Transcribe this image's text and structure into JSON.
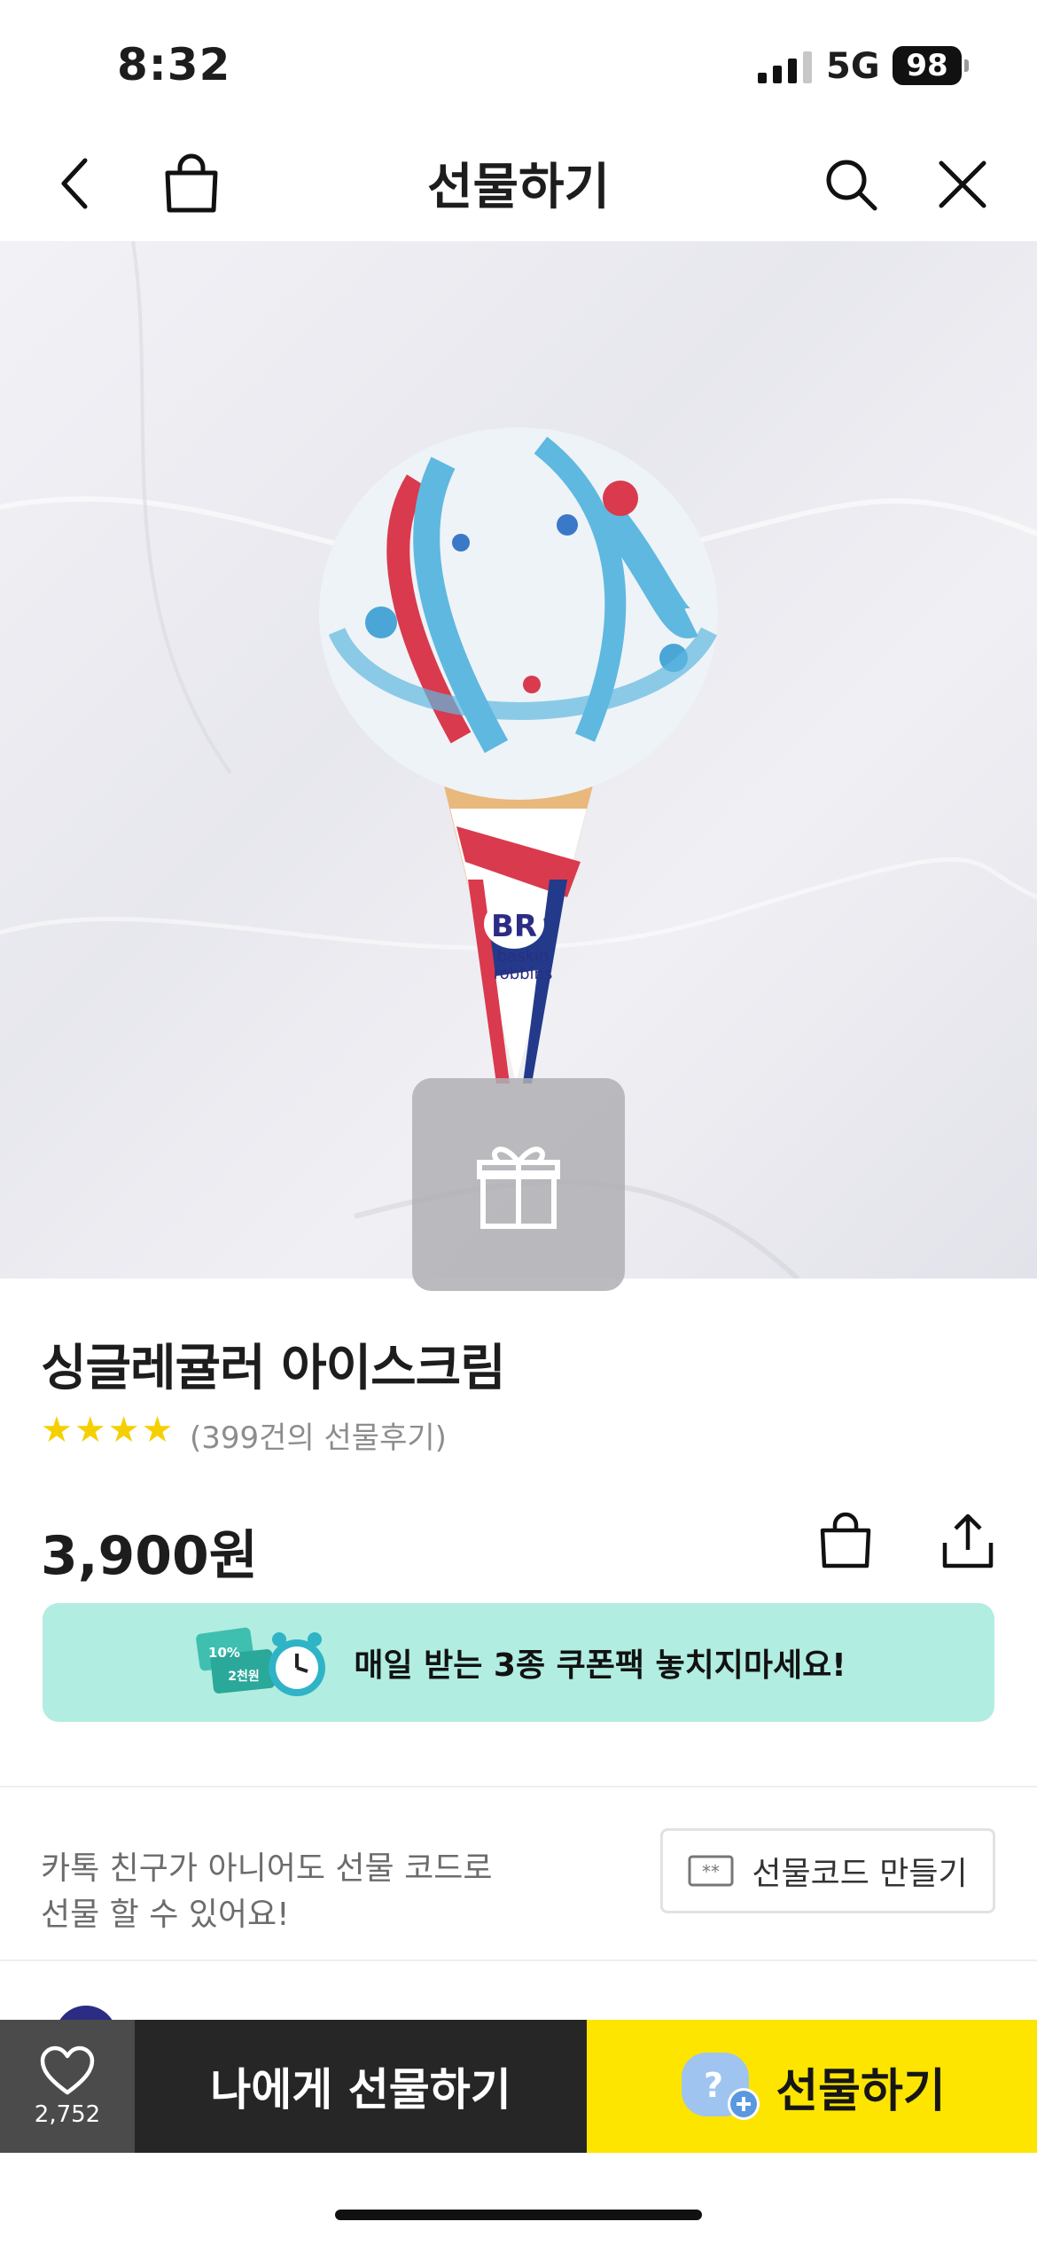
{
  "status_bar": {
    "time": "8:32",
    "network": "5G",
    "battery": "98"
  },
  "nav": {
    "title": "선물하기",
    "icons": [
      "back-icon",
      "bag-icon",
      "search-icon",
      "close-icon"
    ]
  },
  "product": {
    "image_alt": "Baskin Robbins single regular ice cream cone",
    "title": "싱글레귤러 아이스크림",
    "rating_stars": 4,
    "review_text": "(399건의 선물후기)",
    "price": "3,900원"
  },
  "banner": {
    "coupon_percent": "10%",
    "coupon_amount": "2천원",
    "text": "매일 받는 3종 쿠폰팩 놓치지마세요!"
  },
  "gift_code": {
    "description_line1": "카톡 친구가 아니어도 선물 코드로",
    "description_line2": "선물 할 수 있어요!",
    "button_label": "선물코드 만들기"
  },
  "bottom_bar": {
    "wish_count": "2,752",
    "self_gift_label": "나에게 선물하기",
    "gift_label": "선물하기"
  },
  "colors": {
    "accent_yellow": "#fee500",
    "banner_mint": "#b1ede0",
    "dark": "#262626",
    "star": "#f5d000"
  }
}
